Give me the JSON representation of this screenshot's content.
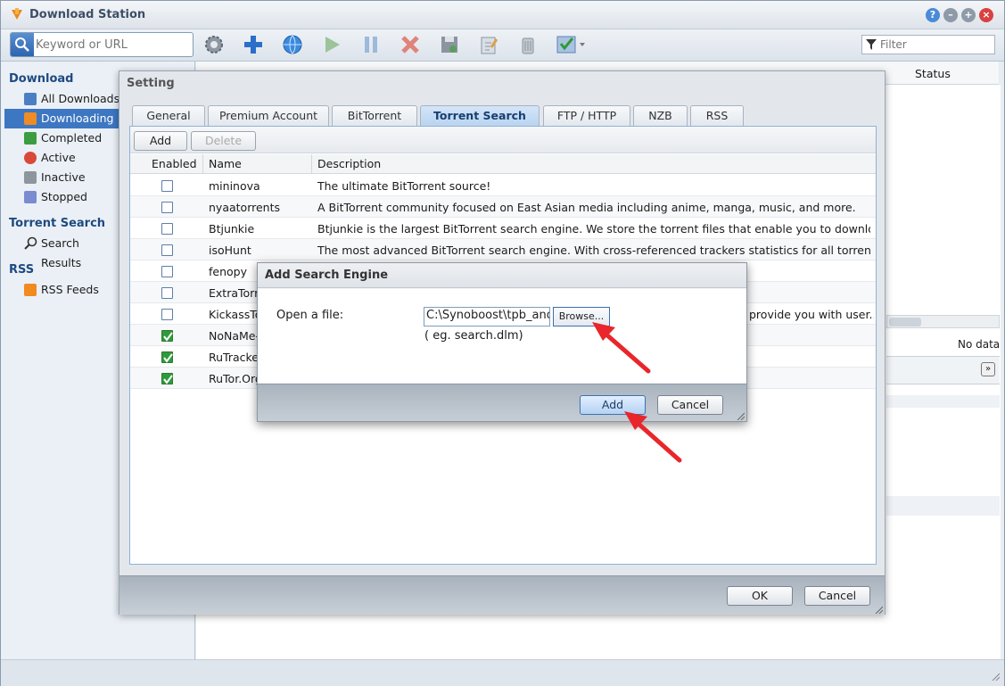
{
  "app": {
    "title": "Download Station"
  },
  "toolbar": {
    "search_placeholder": "Keyword or URL",
    "filter_placeholder": "Filter"
  },
  "sidebar": {
    "download_head": "Download",
    "items": [
      {
        "label": "All Downloads"
      },
      {
        "label": "Downloading"
      },
      {
        "label": "Completed"
      },
      {
        "label": "Active"
      },
      {
        "label": "Inactive"
      },
      {
        "label": "Stopped"
      }
    ],
    "torrent_head": "Torrent Search",
    "search_results": "Search Results",
    "rss_head": "RSS",
    "rss_feeds": "RSS Feeds"
  },
  "list": {
    "status_col": "Status",
    "nodata": "No data"
  },
  "setting": {
    "title": "Setting",
    "tabs": [
      "General",
      "Premium Account",
      "BitTorrent",
      "Torrent Search",
      "FTP / HTTP",
      "NZB",
      "RSS"
    ],
    "add_label": "Add",
    "delete_label": "Delete",
    "col_enabled": "Enabled",
    "col_name": "Name",
    "col_desc": "Description",
    "rows": [
      {
        "name": "mininova",
        "desc": "The ultimate BitTorrent source!",
        "enabled": false
      },
      {
        "name": "nyaatorrents",
        "desc": "A BitTorrent community focused on East Asian media including anime, manga, music, and more.",
        "enabled": false
      },
      {
        "name": "Btjunkie",
        "desc": "Btjunkie is the largest BitTorrent search engine. We store the torrent files that enable you to download file...",
        "enabled": false
      },
      {
        "name": "isoHunt",
        "desc": "The most advanced BitTorrent search engine. With cross-referenced trackers statistics for all torrents inde...",
        "enabled": false
      },
      {
        "name": "fenopy",
        "desc": "",
        "enabled": false
      },
      {
        "name": "ExtraTorr",
        "desc": "",
        "enabled": false
      },
      {
        "name": "KickassTo",
        "desc": "provide you with user...",
        "enabled": false
      },
      {
        "name": "NoNaMe-C",
        "desc": "",
        "enabled": true
      },
      {
        "name": "RuTracke",
        "desc": "",
        "enabled": true
      },
      {
        "name": "RuTor.Org",
        "desc": "",
        "enabled": true
      }
    ],
    "ok_label": "OK",
    "cancel_label": "Cancel"
  },
  "add_engine": {
    "title": "Add Search Engine",
    "open_file_label": "Open a file:",
    "file_value": "C:\\Synoboost\\tpb_and",
    "browse_label": "Browse...",
    "example": "( eg. search.dlm)",
    "add_label": "Add",
    "cancel_label": "Cancel"
  },
  "colors": {
    "accent": "#3d77c1",
    "arrow": "#e8262b",
    "check": "#2f9a3a"
  }
}
